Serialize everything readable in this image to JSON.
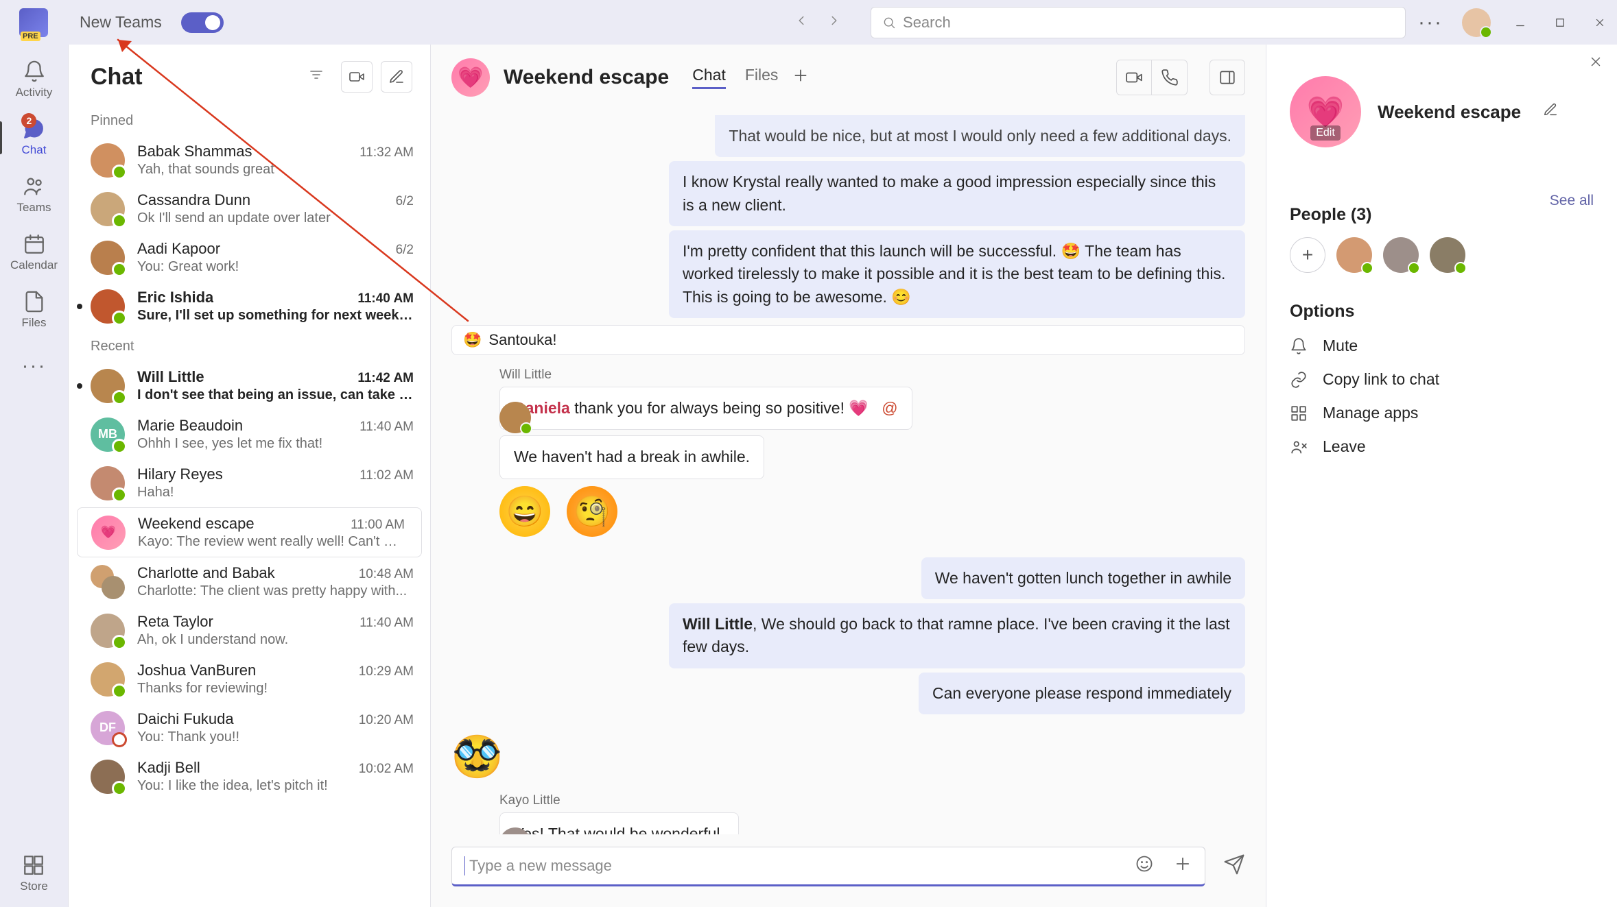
{
  "titlebar": {
    "new_teams_label": "New Teams",
    "search_placeholder": "Search"
  },
  "rail": {
    "activity": "Activity",
    "chat": "Chat",
    "chat_badge": "2",
    "teams": "Teams",
    "calendar": "Calendar",
    "files": "Files",
    "store": "Store"
  },
  "chatlist": {
    "title": "Chat",
    "pinned_label": "Pinned",
    "recent_label": "Recent",
    "pinned": [
      {
        "name": "Babak Shammas",
        "time": "11:32 AM",
        "preview": "Yah, that sounds great",
        "avatar": "#d09060",
        "unread": false
      },
      {
        "name": "Cassandra Dunn",
        "time": "6/2",
        "preview": "Ok I'll send an update over later",
        "avatar": "#caa77a",
        "unread": false
      },
      {
        "name": "Aadi Kapoor",
        "time": "6/2",
        "preview": "You: Great work!",
        "avatar": "#b97f4d",
        "unread": false
      },
      {
        "name": "Eric Ishida",
        "time": "11:40 AM",
        "preview": "Sure, I'll set up something for next week to...",
        "avatar": "#c1572e",
        "unread": true
      }
    ],
    "recent": [
      {
        "name": "Will Little",
        "time": "11:42 AM",
        "preview": "I don't see that being an issue, can take t...",
        "avatar": "#b8864e",
        "unread": true
      },
      {
        "name": "Marie Beaudoin",
        "time": "11:40 AM",
        "preview": "Ohhh I see, yes let me fix that!",
        "avatar": "#5fbea0",
        "initials": "MB",
        "unread": false
      },
      {
        "name": "Hilary Reyes",
        "time": "11:02 AM",
        "preview": "Haha!",
        "avatar": "#c48a70",
        "unread": false
      },
      {
        "name": "Weekend escape",
        "time": "11:00 AM",
        "preview": "Kayo: The review went really well! Can't wai...",
        "avatar": "heart",
        "unread": false,
        "selected": true
      },
      {
        "name": "Charlotte and Babak",
        "time": "10:48 AM",
        "preview": "Charlotte: The client was pretty happy with...",
        "avatar": "pair",
        "unread": false
      },
      {
        "name": "Reta Taylor",
        "time": "11:40 AM",
        "preview": "Ah, ok I understand now.",
        "avatar": "#bfa58a",
        "unread": false
      },
      {
        "name": "Joshua VanBuren",
        "time": "10:29 AM",
        "preview": "Thanks for reviewing!",
        "avatar": "#d2a66f",
        "unread": false
      },
      {
        "name": "Daichi Fukuda",
        "time": "10:20 AM",
        "preview": "You: Thank you!!",
        "avatar": "#d7a6d7",
        "initials": "DF",
        "away": true,
        "unread": false
      },
      {
        "name": "Kadji Bell",
        "time": "10:02 AM",
        "preview": "You: I like the idea, let's pitch it!",
        "avatar": "#8c6e54",
        "unread": false
      }
    ]
  },
  "conversation": {
    "title": "Weekend escape",
    "tabs": {
      "chat": "Chat",
      "files": "Files"
    },
    "messages": {
      "m0_cut": "That would be nice, but at most I would only need a few additional days.",
      "m1": "I know Krystal really wanted to make a good impression especially since this is a new client.",
      "m2": "I'm pretty confident that this launch will be successful. 🤩 The team has worked tirelessly to make it possible and it is the best team to be defining this. This is going to be awesome. 😊",
      "reaction1": "Santouka!",
      "sender_will": "Will Little",
      "m3_mention": "Daniela",
      "m3_rest": " thank you for always being so positive! 💗",
      "m4": "We haven't had a break in awhile.",
      "m5": "We haven't gotten lunch together in awhile",
      "m6_mention": "Will Little",
      "m6_rest": ", We should go back to that ramne place. I've been craving it the last few days.",
      "m7": "Can everyone please respond immediately",
      "sender_kayo": "Kayo Little",
      "m8": "Yes! That would be wonderful."
    },
    "compose_placeholder": "Type a new message"
  },
  "info": {
    "title": "Weekend escape",
    "edit_label": "Edit",
    "people_title": "People (3)",
    "see_all": "See all",
    "options_title": "Options",
    "options": {
      "mute": "Mute",
      "copy": "Copy link to chat",
      "apps": "Manage apps",
      "leave": "Leave"
    }
  }
}
